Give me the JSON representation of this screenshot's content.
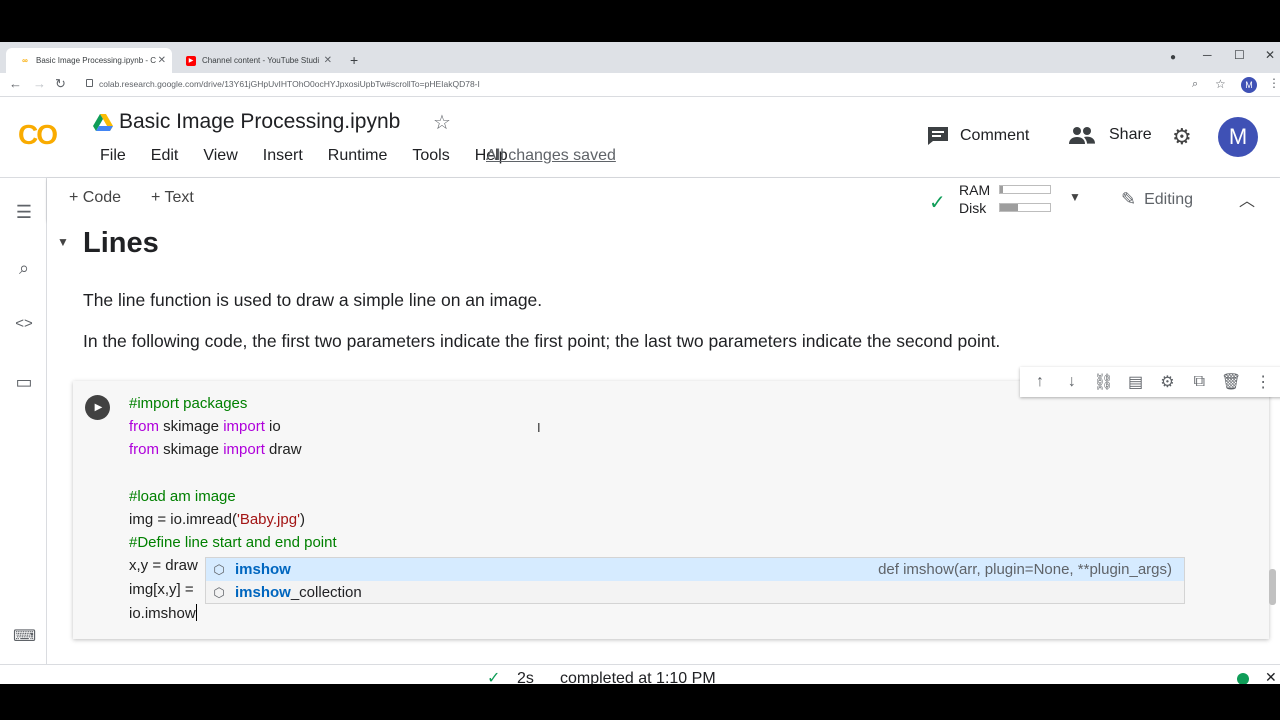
{
  "browser": {
    "tabs": [
      {
        "title": "Basic Image Processing.ipynb - C",
        "favicon": "colab-icon"
      },
      {
        "title": "Channel content - YouTube Studi",
        "favicon": "youtube-icon"
      }
    ],
    "new_tab": "+",
    "url": "colab.research.google.com/drive/13Y61jGHpUvIHTOhO0ocHYJpxosiUpbTw#scrollTo=pHEIakQD78-I",
    "profile_initial": "M"
  },
  "header": {
    "logo": "CO",
    "title": "Basic Image Processing.ipynb",
    "menu": [
      "File",
      "Edit",
      "View",
      "Insert",
      "Runtime",
      "Tools",
      "Help"
    ],
    "save_status": "All changes saved",
    "comment_label": "Comment",
    "share_label": "Share",
    "avatar_initial": "M"
  },
  "toolbar": {
    "code_label": "Code",
    "text_label": "Text",
    "ram_label": "RAM",
    "disk_label": "Disk",
    "ram_fraction": 0.05,
    "disk_fraction": 0.35,
    "editing_label": "Editing"
  },
  "notebook": {
    "section_title": "Lines",
    "paragraphs": [
      "The line function is used to draw a simple line on an image.",
      "In the following code, the first two parameters indicate the first point; the last two parameters indicate the second point."
    ],
    "code_lines": [
      [
        {
          "t": "#import packages",
          "c": "cm"
        }
      ],
      [
        {
          "t": "from",
          "c": "kw"
        },
        {
          "t": " skimage ",
          "c": ""
        },
        {
          "t": "import",
          "c": "kw"
        },
        {
          "t": " io",
          "c": ""
        }
      ],
      [
        {
          "t": "from",
          "c": "kw"
        },
        {
          "t": " skimage ",
          "c": ""
        },
        {
          "t": "import",
          "c": "kw"
        },
        {
          "t": " draw",
          "c": ""
        }
      ],
      [
        {
          "t": "",
          "c": ""
        }
      ],
      [
        {
          "t": "#load am image",
          "c": "cm"
        }
      ],
      [
        {
          "t": "img = io.imread(",
          "c": ""
        },
        {
          "t": "'Baby.jpg'",
          "c": "st"
        },
        {
          "t": ")",
          "c": ""
        }
      ],
      [
        {
          "t": "#Define line start and end point",
          "c": "cm"
        }
      ],
      [
        {
          "t": "x,y = draw",
          "c": ""
        }
      ],
      [
        {
          "t": "img[x,y] = ",
          "c": ""
        }
      ],
      [
        {
          "t": "io.imshow",
          "c": ""
        }
      ]
    ],
    "autocomplete": [
      {
        "match": "imshow",
        "rest": "",
        "detail": "def imshow(arr, plugin=None, **plugin_args)"
      },
      {
        "match": "imshow",
        "rest": "_collection",
        "detail": ""
      }
    ]
  },
  "status": {
    "duration": "2s",
    "text": "completed at 1:10 PM"
  }
}
